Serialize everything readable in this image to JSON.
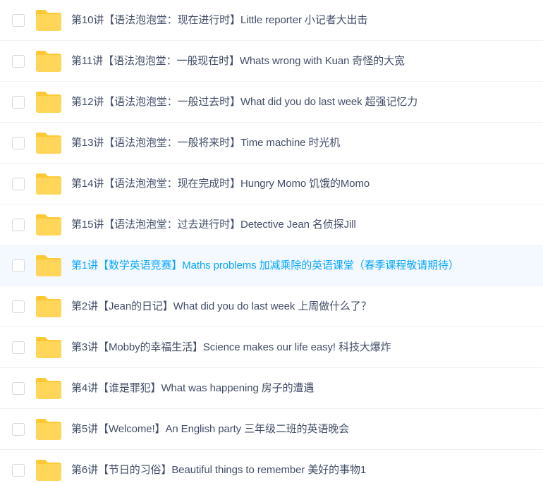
{
  "colors": {
    "text": "#424e67",
    "hover_text": "#06a7ff",
    "hover_background": "#f4f8ff",
    "folder": "#ffd659",
    "folder_tab": "#ffc933",
    "divider": "#f1f2f5"
  },
  "file_list": {
    "hovered_row": "第1讲【数学英语竞赛】Maths problems 加减乘除的英语课堂（春季课程敬请期待）",
    "items": [
      {
        "name": "第10讲【语法泡泡堂：现在进行时】Little reporter 小记者大出击",
        "icon": "folder-icon",
        "checked": false
      },
      {
        "name": "第11讲【语法泡泡堂：一般现在时】Whats wrong with Kuan 奇怪的大宽",
        "icon": "folder-icon",
        "checked": false
      },
      {
        "name": "第12讲【语法泡泡堂：一般过去时】What did you do last week 超强记忆力",
        "icon": "folder-icon",
        "checked": false
      },
      {
        "name": "第13讲【语法泡泡堂：一般将来时】Time machine 时光机",
        "icon": "folder-icon",
        "checked": false
      },
      {
        "name": "第14讲【语法泡泡堂：现在完成时】Hungry Momo 饥饿的Momo",
        "icon": "folder-icon",
        "checked": false
      },
      {
        "name": "第15讲【语法泡泡堂：过去进行时】Detective Jean 名侦探Jill",
        "icon": "folder-icon",
        "checked": false
      },
      {
        "name": "第1讲【数学英语竞赛】Maths problems 加减乘除的英语课堂（春季课程敬请期待）",
        "icon": "folder-icon",
        "checked": false
      },
      {
        "name": "第2讲【Jean的日记】What did you do last week 上周做什么了？",
        "icon": "folder-icon",
        "checked": false
      },
      {
        "name": "第3讲【Mobby的幸福生活】Science makes our life easy! 科技大爆炸",
        "icon": "folder-icon",
        "checked": false
      },
      {
        "name": "第4讲【谁是罪犯】What was happening 房子的遭遇",
        "icon": "folder-icon",
        "checked": false
      },
      {
        "name": "第5讲【Welcome!】An English party 三年级二班的英语晚会",
        "icon": "folder-icon",
        "checked": false
      },
      {
        "name": "第6讲【节日的习俗】Beautiful things to remember 美好的事物1",
        "icon": "folder-icon",
        "checked": false
      }
    ]
  }
}
